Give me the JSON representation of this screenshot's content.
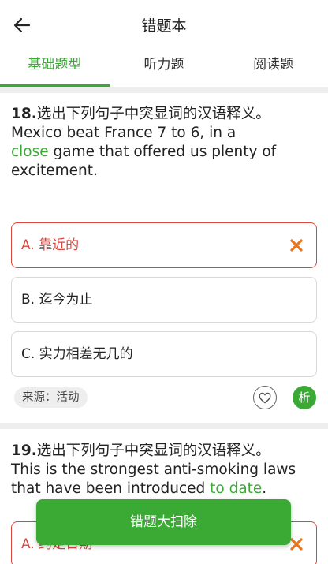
{
  "header": {
    "title": "错题本",
    "back_icon": "arrow-left-icon"
  },
  "tabs": [
    {
      "label": "基础题型",
      "active": true
    },
    {
      "label": "听力题",
      "active": false
    },
    {
      "label": "阅读题",
      "active": false
    }
  ],
  "questions": [
    {
      "number": "18.",
      "prompt": "选出下列句子中突显词的汉语释义。",
      "sentence_before": "Mexico beat France 7 to 6, in a",
      "highlight": "close",
      "sentence_after": " game that offered us plenty of excitement.",
      "options": [
        {
          "label": "A. 靠近的",
          "state": "wrong"
        },
        {
          "label": "B. 迄今为止",
          "state": "normal"
        },
        {
          "label": "C. 实力相差无几的",
          "state": "normal"
        }
      ],
      "source": "来源：活动",
      "analyze_label": "析"
    },
    {
      "number": "19.",
      "prompt": "选出下列句子中突显词的汉语释义。",
      "sentence_before": "This is the strongest anti-smoking laws that have been introduced ",
      "highlight": "to date",
      "sentence_after": ".",
      "options": [
        {
          "label": "A. 约定日期",
          "state": "wrong"
        }
      ]
    }
  ],
  "sweep_button": "错题大扫除",
  "colors": {
    "accent": "#3aaa35",
    "wrong": "#d9453d"
  }
}
